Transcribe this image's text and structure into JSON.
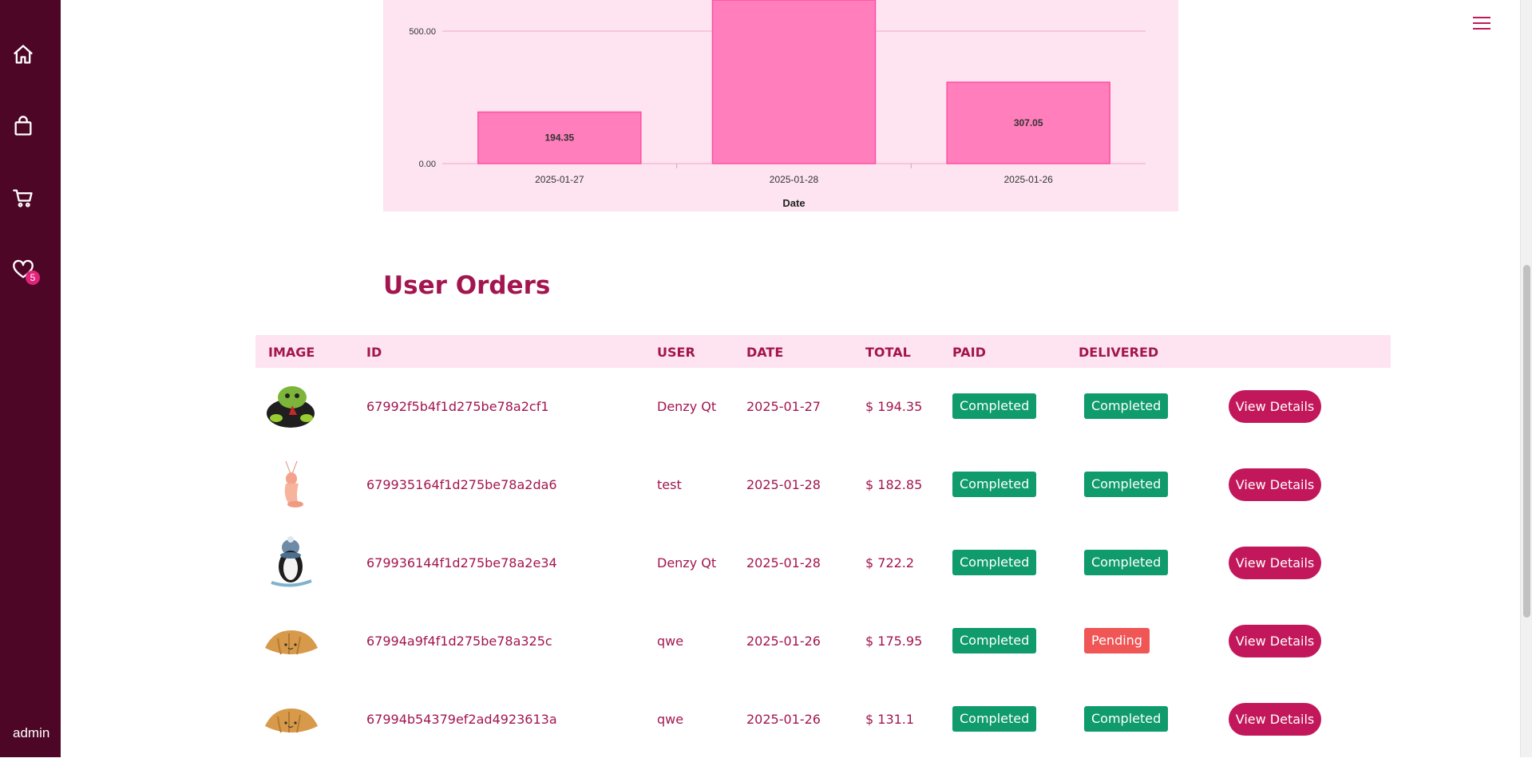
{
  "sidebar": {
    "items": [
      {
        "name": "home-icon"
      },
      {
        "name": "shopping-bag-icon"
      },
      {
        "name": "cart-icon"
      },
      {
        "name": "heart-icon",
        "badge": "5"
      }
    ],
    "user_label": "admin"
  },
  "header": {
    "menu_icon": "hamburger-menu-icon"
  },
  "chart_data": {
    "type": "bar",
    "categories": [
      "2025-01-27",
      "2025-01-28",
      "2025-01-26"
    ],
    "values": [
      194.35,
      722.2,
      307.05
    ],
    "data_labels": [
      "194.35",
      "",
      "307.05"
    ],
    "xlabel": "Date",
    "y_ticks": [
      "0.00",
      "500.00"
    ],
    "grid": true,
    "colors": {
      "bar_fill": "#ff7ebb",
      "bar_stroke": "#ff4fa0",
      "panel_bg": "#fde4f0"
    }
  },
  "orders": {
    "title": "User Orders",
    "headers": {
      "image": "IMAGE",
      "id": "ID",
      "user": "USER",
      "date": "DATE",
      "total": "TOTAL",
      "paid": "PAID",
      "delivered": "DELIVERED"
    },
    "rows": [
      {
        "image": "plush-toy-image",
        "id": "67992f5b4f1d275be78a2cf1",
        "user": "Denzy Qt",
        "date": "2025-01-27",
        "total": "$ 194.35",
        "paid": "Completed",
        "delivered": "Completed",
        "action": "View Details"
      },
      {
        "image": "plush-toy-image",
        "id": "679935164f1d275be78a2da6",
        "user": "test",
        "date": "2025-01-28",
        "total": "$ 182.85",
        "paid": "Completed",
        "delivered": "Completed",
        "action": "View Details"
      },
      {
        "image": "plush-toy-image",
        "id": "679936144f1d275be78a2e34",
        "user": "Denzy Qt",
        "date": "2025-01-28",
        "total": "$ 722.2",
        "paid": "Completed",
        "delivered": "Completed",
        "action": "View Details"
      },
      {
        "image": "plush-toy-image",
        "id": "67994a9f4f1d275be78a325c",
        "user": "qwe",
        "date": "2025-01-26",
        "total": "$ 175.95",
        "paid": "Completed",
        "delivered": "Pending",
        "action": "View Details"
      },
      {
        "image": "plush-toy-image",
        "id": "67994b54379ef2ad4923613a",
        "user": "qwe",
        "date": "2025-01-26",
        "total": "$ 131.1",
        "paid": "Completed",
        "delivered": "Completed",
        "action": "View Details"
      }
    ]
  },
  "colors": {
    "sidebar": "#4d0626",
    "accent": "#c2185b",
    "completed": "#0f9b6c",
    "pending": "#f05656"
  }
}
